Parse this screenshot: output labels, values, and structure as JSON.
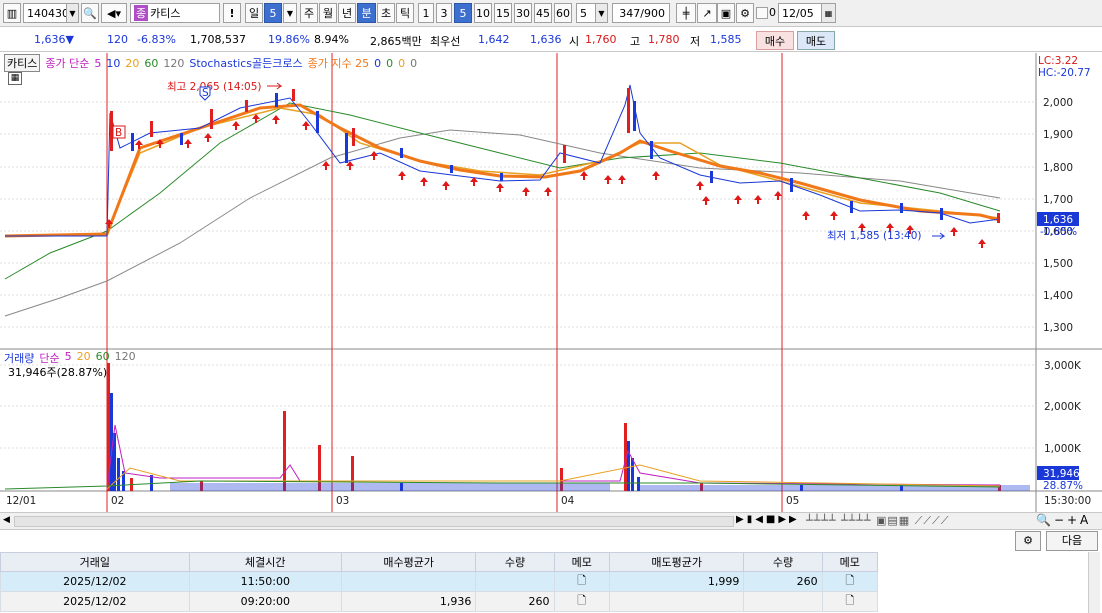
{
  "toolbar": {
    "code": "140430",
    "name": "카티스",
    "name_badge": "종",
    "bang": "!",
    "period_day": "일",
    "period_num": "5",
    "periods": [
      "주",
      "월",
      "년",
      "분",
      "초",
      "틱"
    ],
    "minute_opts": [
      "1",
      "3",
      "5",
      "10",
      "15",
      "30",
      "45",
      "60"
    ],
    "interval": "5",
    "count": "347/900",
    "date": "12/05",
    "chk_zero": "0"
  },
  "quote": {
    "price": "1,636▼",
    "change": "120",
    "change_rate": "-6.83%",
    "volume": "1,708,537",
    "turnover_rate": "19.86%",
    "ratio": "8.94%",
    "amount": "2,865백만",
    "best_label": "최우선",
    "best_ask": "1,642",
    "best_bid": "1,636",
    "open_label": "시",
    "open": "1,760",
    "high_label": "고",
    "high": "1,780",
    "low_label": "저",
    "low": "1,585",
    "buy": "매수",
    "sell": "매도"
  },
  "legend": {
    "name": "카티스",
    "sma_label": "종가 단순",
    "sma": [
      "5",
      "10",
      "20",
      "60",
      "120"
    ],
    "stoch": "Stochastics골든크로스",
    "ema_label": "종가 지수 25",
    "ema_zeros": [
      "0",
      "0",
      "0",
      "0"
    ],
    "lc": "LC:3.22",
    "hc": "HC:-20.77"
  },
  "annot": {
    "high": "최고 2,065 (14:05)",
    "low": "최저 1,585 (13:40)",
    "buy_marker": "B",
    "sell_marker": "S"
  },
  "price_axis": [
    "2,000",
    "1,900",
    "1,800",
    "1,700",
    "1,600",
    "1,500",
    "1,400",
    "1,300"
  ],
  "current_price": "1,636",
  "current_pct": "-0.85%",
  "volume_legend": {
    "label": "거래량",
    "sma_label": "단순",
    "sma": [
      "5",
      "20",
      "60",
      "120"
    ],
    "last": "31,946주(28.87%)"
  },
  "volume_axis": [
    "3,000K",
    "2,000K",
    "1,000K"
  ],
  "volume_current": "31,946",
  "volume_pct": "28.87%",
  "date_axis": [
    "12/01",
    "02",
    "03",
    "04",
    "05"
  ],
  "time_label": "15:30:00",
  "chart_data": {
    "type": "candlestick",
    "x": [
      "12/01",
      "12/02",
      "12/03",
      "12/04",
      "12/05"
    ],
    "close": [
      1580,
      1830,
      1770,
      1756,
      1636
    ],
    "ylim": [
      1250,
      2100
    ],
    "high": 2065,
    "low": 1585,
    "volume_ylim": [
      0,
      3200000
    ]
  },
  "actions": {
    "next": "다음"
  },
  "table": {
    "headers": [
      "거래일",
      "체결시간",
      "매수평균가",
      "수량",
      "메모",
      "매도평균가",
      "수량",
      "메모"
    ],
    "rows": [
      [
        "2025/12/02",
        "11:50:00",
        "",
        "",
        "",
        "1,999",
        "260",
        ""
      ],
      [
        "2025/12/02",
        "09:20:00",
        "1,936",
        "260",
        "",
        "",
        "",
        ""
      ]
    ]
  }
}
